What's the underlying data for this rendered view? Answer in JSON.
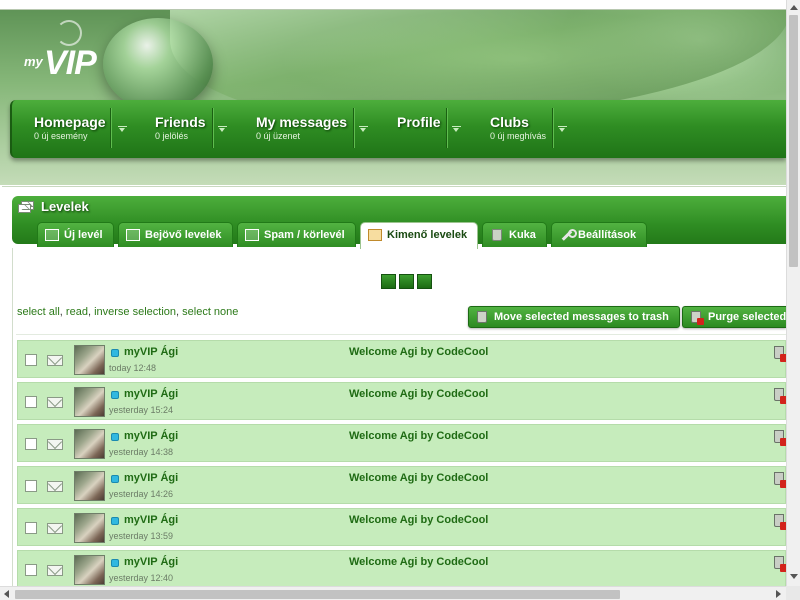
{
  "logo": {
    "prefix": "my",
    "name": "VIP"
  },
  "nav": [
    {
      "title": "Homepage",
      "sub": "0 új esemény"
    },
    {
      "title": "Friends",
      "sub": "0 jelölés"
    },
    {
      "title": "My messages",
      "sub": "0 új üzenet"
    },
    {
      "title": "Profile",
      "sub": ""
    },
    {
      "title": "Clubs",
      "sub": "0 új meghívás"
    }
  ],
  "section": {
    "title": "Levelek"
  },
  "tabs": [
    {
      "label": "Új levél",
      "icon": "compose-icon"
    },
    {
      "label": "Bejövő levelek",
      "icon": "inbox-icon"
    },
    {
      "label": "Spam / körlevél",
      "icon": "spam-icon"
    },
    {
      "label": "Kimenő levelek",
      "icon": "outbox-icon",
      "active": true
    },
    {
      "label": "Kuka",
      "icon": "trash-icon"
    },
    {
      "label": "Beállítások",
      "icon": "wrench-icon"
    }
  ],
  "selection": {
    "select_all": "select all",
    "read": "read",
    "inverse": "inverse selection",
    "none": "select none",
    "sep": ", "
  },
  "actions": {
    "move_to_trash": "Move selected messages to trash",
    "purge": "Purge selected"
  },
  "messages": [
    {
      "sender": "myVIP Ági",
      "time": "today 12:48",
      "subject": "Welcome Agi by CodeCool"
    },
    {
      "sender": "myVIP Ági",
      "time": "yesterday 15:24",
      "subject": "Welcome Agi by CodeCool"
    },
    {
      "sender": "myVIP Ági",
      "time": "yesterday 14:38",
      "subject": "Welcome Agi by CodeCool"
    },
    {
      "sender": "myVIP Ági",
      "time": "yesterday 14:26",
      "subject": "Welcome Agi by CodeCool"
    },
    {
      "sender": "myVIP Ági",
      "time": "yesterday 13:59",
      "subject": "Welcome Agi by CodeCool"
    },
    {
      "sender": "myVIP Ági",
      "time": "yesterday 12:40",
      "subject": "Welcome Agi by CodeCool"
    }
  ],
  "colors": {
    "accent": "#2f8d23",
    "row_bg": "#c6ecbc",
    "link": "#2c7a19"
  }
}
